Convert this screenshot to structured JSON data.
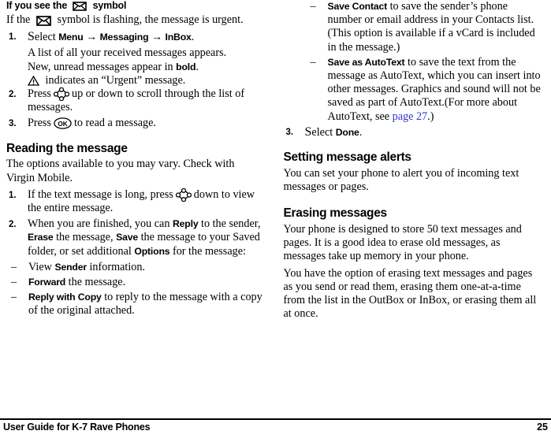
{
  "document": {
    "footer_title": "User Guide for K-7 Rave Phones",
    "page_number": "25",
    "link_color": "#3333cc"
  },
  "left_column": {
    "heading_1": {
      "prefix": "If you see the",
      "icon": "envelope-icon",
      "suffix": "symbol"
    },
    "intro_1": {
      "prefix": "If the",
      "icon": "envelope-icon",
      "suffix": "symbol is flashing, the message is urgent."
    },
    "steps": [
      {
        "num": "1.",
        "lead_cap": "S",
        "lead_rest": "elect ",
        "bold_1": "Menu",
        "arrow_1": "→",
        "bold_2": "Messaging",
        "arrow_2": "→",
        "bold_3": "InBox",
        "tail": ".",
        "sub_lines": [
          "A list of all your received messages appears.",
          "New, unread messages appear in bold."
        ],
        "bold_in_sub": "bold",
        "warn_line": {
          "icon": "warning-triangle-icon",
          "text": "indicates an “Urgent” message."
        }
      },
      {
        "num": "2.",
        "pre_icon": "Press",
        "icon": "navigation-pad-icon",
        "post_icon": "up or down to scroll through the list of messages."
      },
      {
        "num": "3.",
        "pre_icon": "Press",
        "icon": "ok-button-icon",
        "post_icon": "to read a message."
      }
    ],
    "heading_2": "Reading the message",
    "intro_2": "The options available to you may vary. Check with Virgin Mobile.",
    "steps_2": [
      {
        "num": "1.",
        "pre_icon": "If the text message is long, press",
        "icon": "navigation-pad-icon",
        "post_icon": "down to view the entire message."
      },
      {
        "num": "2.",
        "text_a": "When you are finished, you can ",
        "bold_a": "Reply",
        "text_b": " to the sender, ",
        "bold_b": "Erase",
        "text_c": " the message, ",
        "bold_c": "Save",
        "text_d": " the message to your Saved folder, or set additional ",
        "bold_d": "Options",
        "text_e": " for the message:"
      }
    ],
    "dash_items": [
      {
        "dash": "–",
        "pre": "View ",
        "bold": "Sender",
        "post": " information."
      },
      {
        "dash": "–",
        "pre": "",
        "bold": "Forward",
        "post": " the message."
      },
      {
        "dash": "–",
        "pre": "",
        "bold": "Reply with Copy",
        "post": " to reply to the message with a copy of the original attached."
      }
    ]
  },
  "right_column": {
    "dash_items": [
      {
        "dash": "–",
        "bold": "Save Contact",
        "post": " to save the sender’s phone number or email address in your Contacts list. (This option is available if a vCard is included in the message.)"
      },
      {
        "dash": "–",
        "bold": "Save as AutoText",
        "post_a": " to save the text from the message as AutoText, which you can insert into other messages. Graphics and sound will not be saved as part of AutoText.(For more about AutoText, see ",
        "link": "page 27",
        "post_b": ".)"
      }
    ],
    "step_3": {
      "num": "3.",
      "lead_cap": "S",
      "lead_rest": "elect ",
      "bold": "Done",
      "tail": "."
    },
    "heading_alerts": "Setting message alerts",
    "alerts_body": "You can set your phone to alert you of incoming text messages or pages.",
    "heading_erasing": "Erasing messages",
    "erasing_body_1": "Your phone is designed to store 50 text messages and pages. It is a good idea to erase old messages, as messages take up memory in your phone.",
    "erasing_body_2": "You have the option of erasing text messages and pages as you send or read them, erasing them one-at-a-time from the list in the OutBox or InBox, or erasing them all at once."
  }
}
